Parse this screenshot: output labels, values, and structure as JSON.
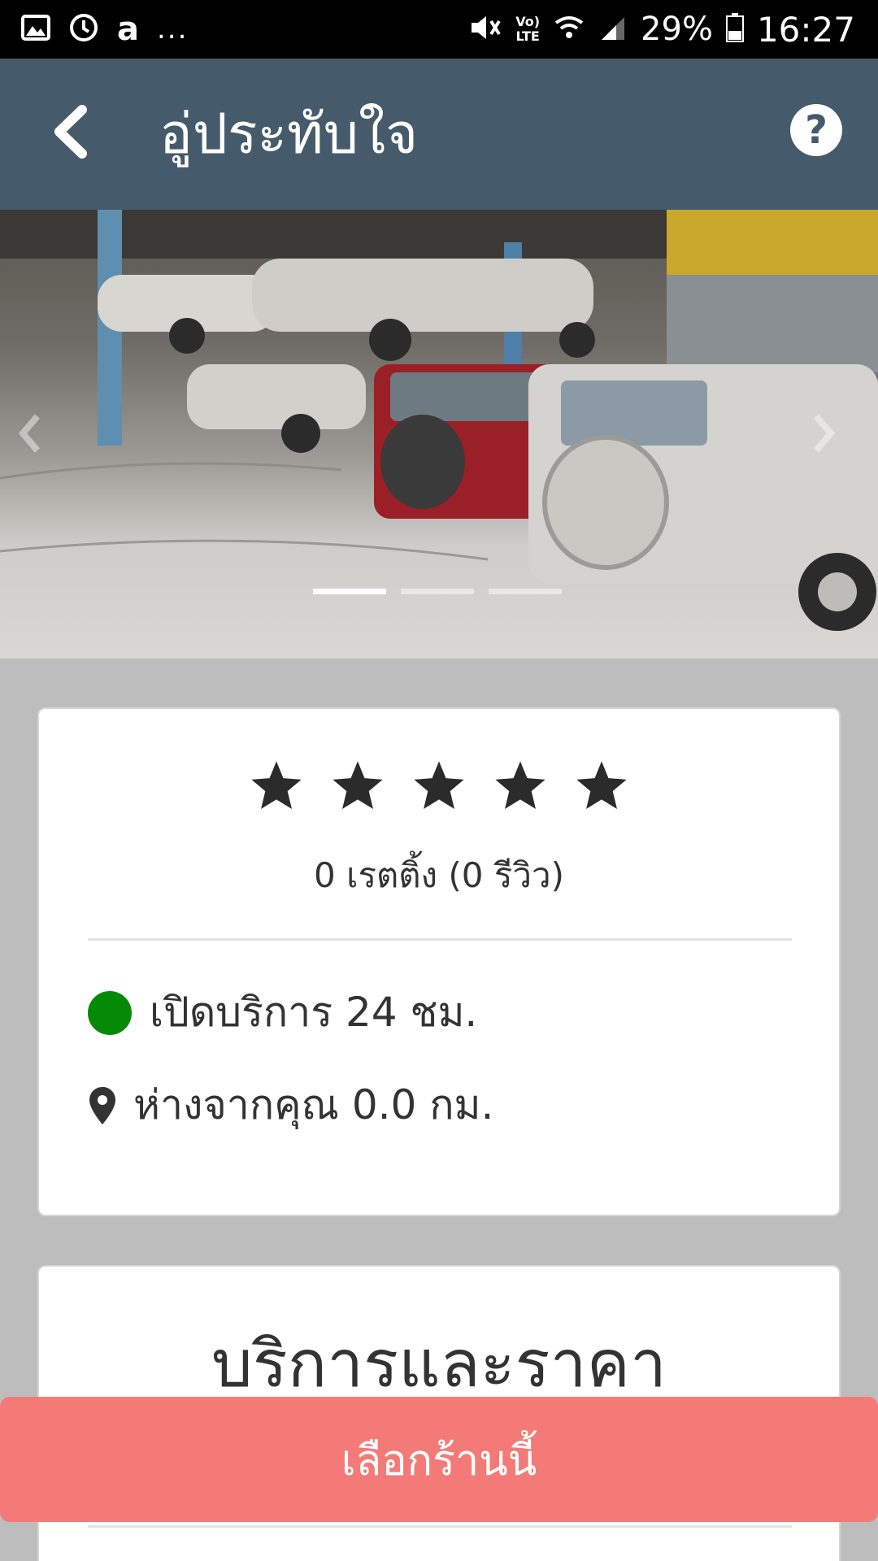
{
  "status_bar": {
    "notifications": [
      "gallery-icon",
      "sync-icon",
      "amazon-icon"
    ],
    "amazon_label": "a",
    "more_dots": "...",
    "battery": "29%",
    "time": "16:27",
    "network_label": "LTE",
    "volte_label": "Vo)"
  },
  "app_bar": {
    "title": "อู่ประทับใจ",
    "background": "#455a6a"
  },
  "carousel": {
    "image_alt": "garage-photo",
    "slide_count": 3,
    "active_index": 0
  },
  "rating": {
    "stars": 5,
    "text": "0 เรตติ้ง (0 รีวิว)"
  },
  "shop_info": {
    "open_status": "เปิดบริการ 24 ชม.",
    "open_color": "#058a05",
    "distance": "ห่างจากคุณ 0.0 กม."
  },
  "services": {
    "title": "บริการและราคา"
  },
  "cta": {
    "label": "เลือกร้านนี้",
    "color": "#f47a78"
  }
}
